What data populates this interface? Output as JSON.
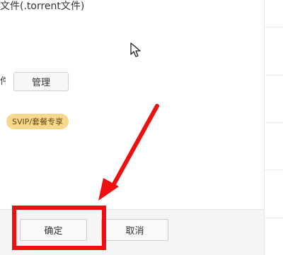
{
  "dialog": {
    "header_text": "文件(.torrent文件)",
    "cut_label": "件",
    "manage_label": "管理",
    "svip_badge": "SVIP/套餐专享"
  },
  "footer": {
    "ok_label": "确定",
    "cancel_label": "取消"
  },
  "icons": {
    "cursor": "mouse-pointer-icon",
    "annotation": "red-arrow-icon"
  },
  "colors": {
    "annotation_red": "#ee1010",
    "badge_bg": "#f6d88d",
    "badge_text": "#6b4511"
  }
}
